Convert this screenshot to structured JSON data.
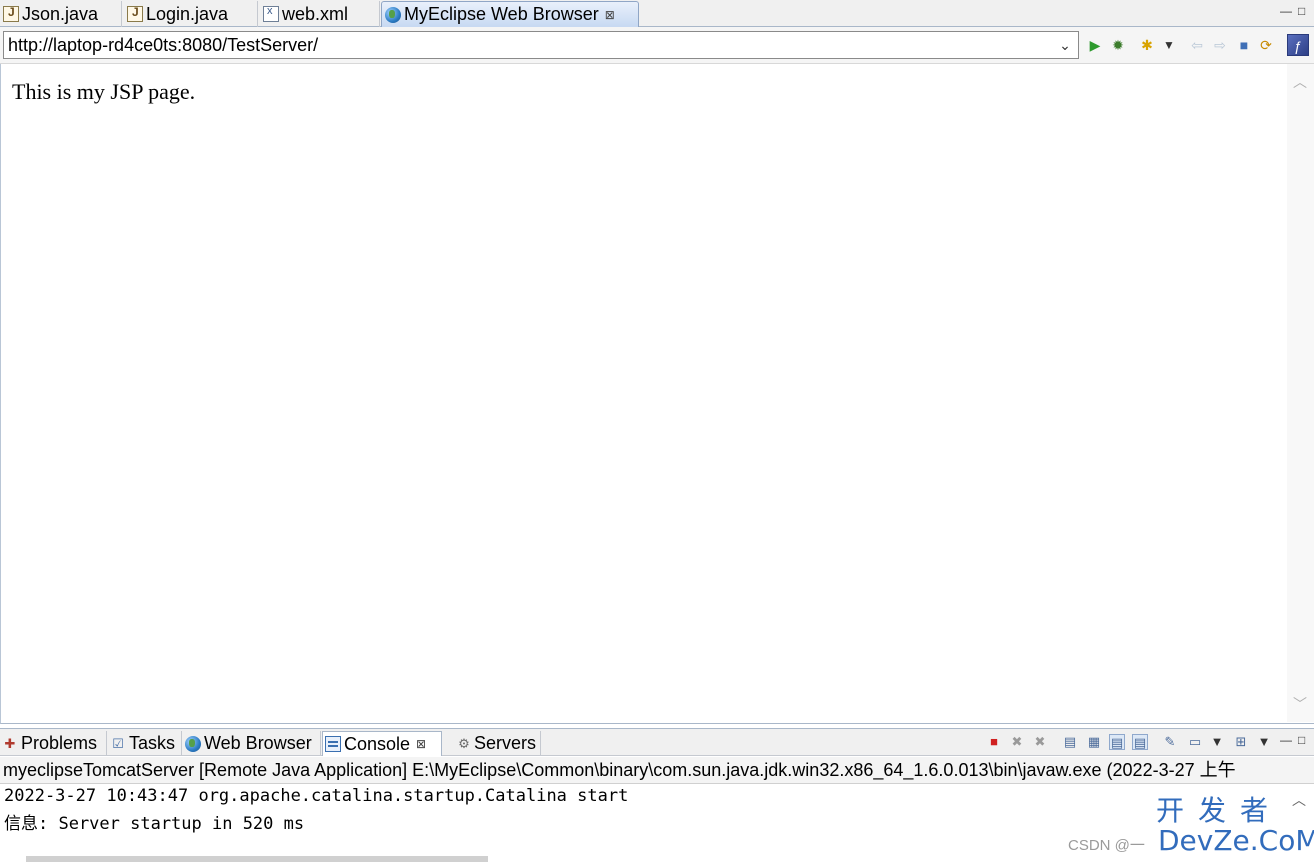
{
  "editor_tabs": [
    {
      "label": "Json.java",
      "icon": "java-file-icon"
    },
    {
      "label": "Login.java",
      "icon": "java-file-icon"
    },
    {
      "label": "web.xml",
      "icon": "xml-file-icon"
    },
    {
      "label": "MyEclipse Web Browser",
      "icon": "globe-icon",
      "active": true,
      "close": "⊠"
    }
  ],
  "window_controls": {
    "minimize": "—",
    "maximize": "□"
  },
  "address_bar": {
    "url": "http://laptop-rd4ce0ts:8080/TestServer/",
    "dropdown": "⌄",
    "icons": [
      "go-icon",
      "debug-icon",
      "favorites-icon",
      "dropdown-icon",
      "back-icon",
      "forward-icon",
      "stop-icon",
      "refresh-icon",
      "perspective-icon"
    ]
  },
  "page": {
    "body_text": "This is my JSP page."
  },
  "view_tabs": [
    {
      "label": "Problems",
      "icon": "problems-icon"
    },
    {
      "label": "Tasks",
      "icon": "tasks-icon"
    },
    {
      "label": "Web Browser",
      "icon": "globe-icon"
    },
    {
      "label": "Console",
      "icon": "console-icon",
      "active": true,
      "close": "⊠"
    },
    {
      "label": "Servers",
      "icon": "servers-icon"
    }
  ],
  "console": {
    "header": "myeclipseTomcatServer [Remote Java Application] E:\\MyEclipse\\Common\\binary\\com.sun.java.jdk.win32.x86_64_1.6.0.013\\bin\\javaw.exe (2022-3-27 上午",
    "lines": [
      "2022-3-27 10:43:47 org.apache.catalina.startup.Catalina start",
      "信息: Server startup in 520 ms"
    ]
  },
  "watermark": {
    "logo_cn": "开发者",
    "logo_en": "DevZe.CoM",
    "csdn": "CSDN @一"
  },
  "colors": {
    "accent": "#1c5db5",
    "terminate": "#d02020",
    "tab_border": "#a9b7c9"
  }
}
